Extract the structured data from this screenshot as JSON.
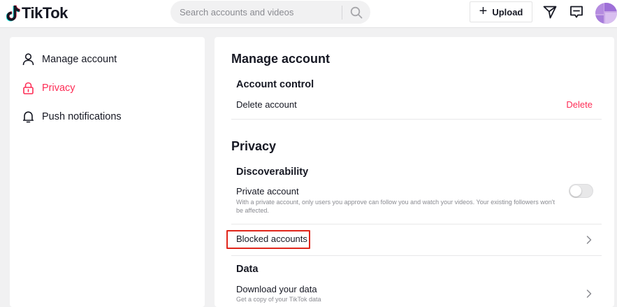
{
  "header": {
    "logo_text": "TikTok",
    "search_placeholder": "Search accounts and videos",
    "upload_label": "Upload"
  },
  "icons": {
    "logo": "tiktok-note-icon",
    "search": "search-icon",
    "upload": "plus-icon",
    "inbox": "send-icon",
    "messages": "message-icon",
    "settings_manage": "person-icon",
    "settings_privacy": "lock-icon",
    "settings_push": "bell-icon",
    "row_arrow": "chevron-right-icon"
  },
  "sidebar": {
    "items": [
      {
        "label": "Manage account",
        "active": false
      },
      {
        "label": "Privacy",
        "active": true
      },
      {
        "label": "Push notifications",
        "active": false
      }
    ]
  },
  "main": {
    "manage_title": "Manage account",
    "account_control": "Account control",
    "delete_account": "Delete account",
    "delete_link": "Delete",
    "privacy_title": "Privacy",
    "discoverability": "Discoverability",
    "private_account": "Private account",
    "private_desc": "With a private account, only users you approve can follow you and watch your videos. Your existing followers won't be affected.",
    "private_enabled": false,
    "blocked_accounts": "Blocked accounts",
    "data_title": "Data",
    "download_data": "Download your data",
    "download_desc": "Get a copy of your TikTok data"
  },
  "colors": {
    "accent": "#fe2c55",
    "highlight": "#e0261b",
    "page_bg": "#f1f1f2"
  }
}
